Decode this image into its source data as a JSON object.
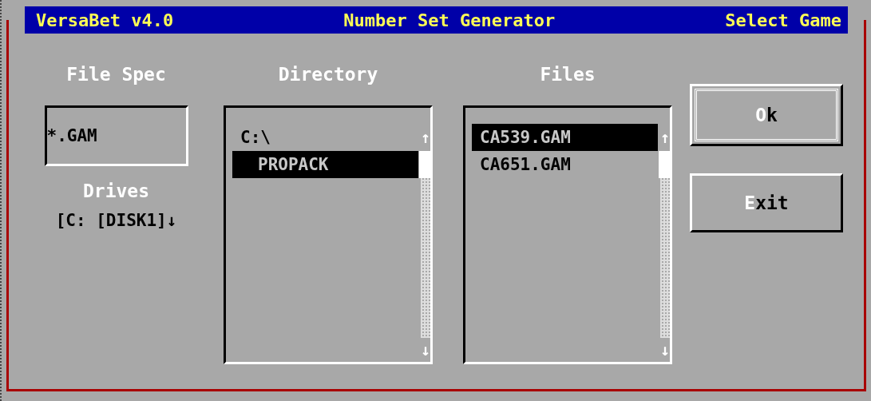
{
  "window": {
    "title_left": "VersaBet v4.0",
    "title_center": "Number Set Generator",
    "title_right": "Select Game"
  },
  "file_spec": {
    "label": "File Spec",
    "value": "*.GAM"
  },
  "drives": {
    "label": "Drives",
    "value": "[C: [DISK1]↓"
  },
  "directory": {
    "label": "Directory",
    "scroll_up": "↑",
    "scroll_down": "↓",
    "items": [
      {
        "name": "C:\\",
        "selected": false,
        "children": [
          {
            "name": "PROPACK",
            "selected": true
          }
        ]
      }
    ]
  },
  "files": {
    "label": "Files",
    "scroll_up": "↑",
    "scroll_down": "↓",
    "items": [
      {
        "name": "CA539.GAM",
        "selected": true
      },
      {
        "name": "CA651.GAM",
        "selected": false
      }
    ]
  },
  "buttons": [
    {
      "label": "**O**k",
      "default": true
    },
    {
      "label": "**E**xit",
      "default": false
    }
  ]
}
